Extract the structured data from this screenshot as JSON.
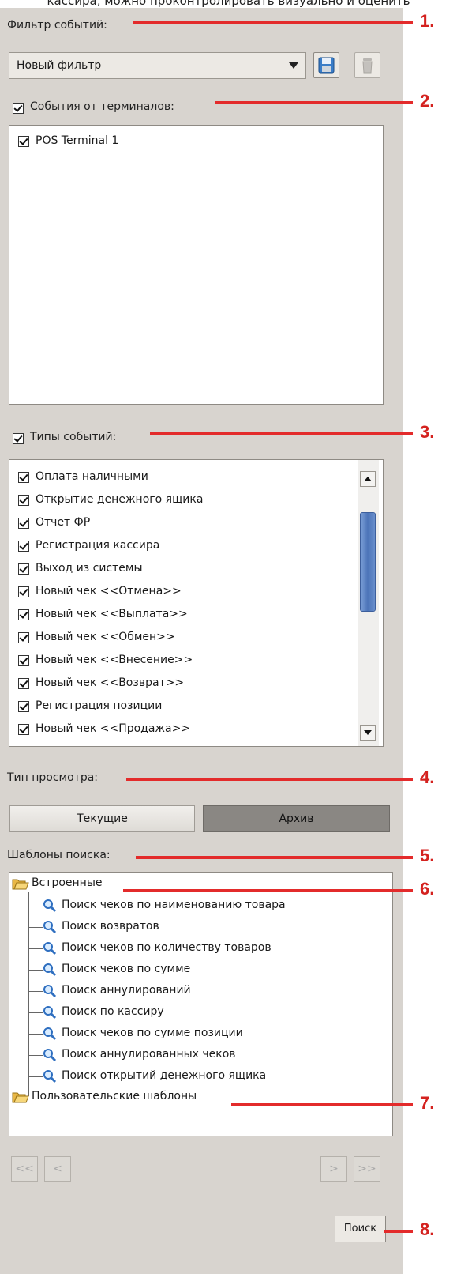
{
  "top_caption": "кассира, можно проконтролировать визуально и оценить",
  "filter": {
    "label": "Фильтр событий:",
    "selected": "Новый фильтр",
    "save_icon": "floppy-disk-icon",
    "delete_icon": "trash-can-icon"
  },
  "terminals": {
    "label": "События от терминалов:",
    "checked": true,
    "items": [
      {
        "label": "POS Terminal 1",
        "checked": true
      }
    ]
  },
  "event_types": {
    "label": "Типы событий:",
    "checked": true,
    "items": [
      {
        "label": "Оплата наличными",
        "checked": true
      },
      {
        "label": "Открытие денежного ящика",
        "checked": true
      },
      {
        "label": "Отчет ФР",
        "checked": true
      },
      {
        "label": "Регистрация кассира",
        "checked": true
      },
      {
        "label": "Выход из системы",
        "checked": true
      },
      {
        "label": "Новый чек <<Отмена>>",
        "checked": true
      },
      {
        "label": "Новый чек <<Выплата>>",
        "checked": true
      },
      {
        "label": "Новый чек <<Обмен>>",
        "checked": true
      },
      {
        "label": "Новый чек <<Внесение>>",
        "checked": true
      },
      {
        "label": "Новый чек <<Возврат>>",
        "checked": true
      },
      {
        "label": "Регистрация позиции",
        "checked": true
      },
      {
        "label": "Новый чек <<Продажа>>",
        "checked": true
      }
    ]
  },
  "view_type": {
    "label": "Тип просмотра:",
    "options": [
      "Текущие",
      "Архив"
    ],
    "selected": "Архив"
  },
  "templates": {
    "label": "Шаблоны поиска:",
    "groups": [
      {
        "label": "Встроенные",
        "icon": "folder-open-icon",
        "items": [
          "Поиск чеков по наименованию товара",
          "Поиск возвратов",
          "Поиск чеков по количеству товаров",
          "Поиск чеков по сумме",
          "Поиск аннулирований",
          "Поиск по кассиру",
          "Поиск чеков по сумме позиции",
          "Поиск аннулированных чеков",
          "Поиск открытий денежного ящика"
        ]
      },
      {
        "label": "Пользовательские шаблоны",
        "icon": "folder-open-icon",
        "items": []
      }
    ]
  },
  "pager": {
    "first": "<<",
    "prev": "<",
    "next": ">",
    "last": ">>"
  },
  "search_button": "Поиск",
  "callouts": [
    "1.",
    "2.",
    "3.",
    "4.",
    "5.",
    "6.",
    "7.",
    "8."
  ],
  "colors": {
    "panel": "#d8d4cf",
    "callout": "#d4221f",
    "scroll_thumb": "#4c74b8",
    "selected_segment": "#8a8783"
  }
}
